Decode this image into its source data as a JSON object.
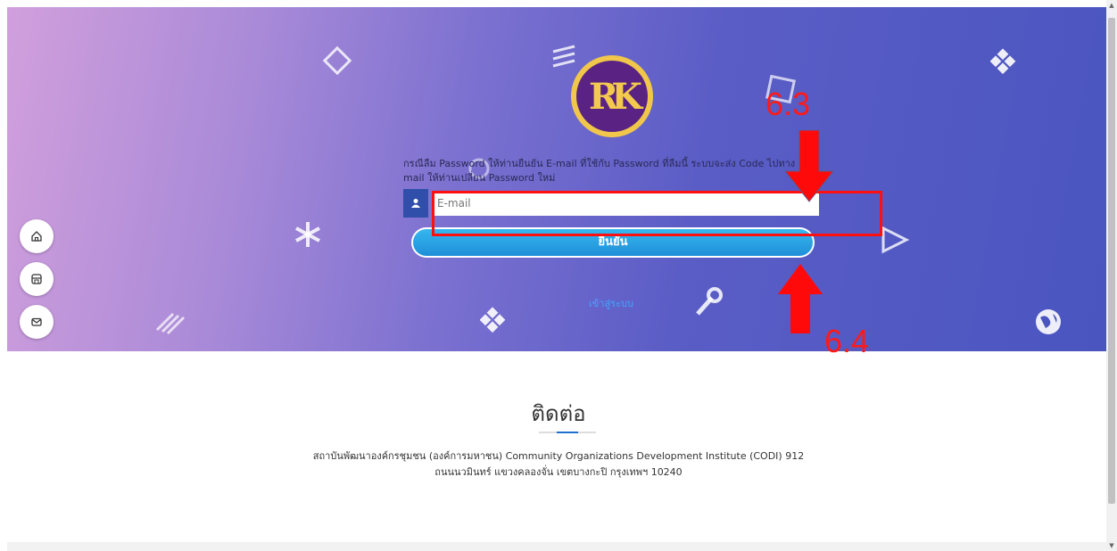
{
  "form": {
    "instruction_line1": "กรณีลืม Password ให้ท่านยืนยัน E-mail ที่ใช้กับ Password ที่ลืมนี้ ระบบจะส่ง Code ไปทาง",
    "instruction_line2": "mail ให้ท่านเปลี่ยน Password ใหม่",
    "email_placeholder": "E-mail",
    "confirm_label": "ยืนยัน",
    "login_link": "เข้าสู่ระบบ"
  },
  "logo": {
    "text": "RK"
  },
  "annotations": {
    "label_a": "6.3",
    "label_b": "6.4",
    "color": "#ff1a1a"
  },
  "side_menu": [
    {
      "icon": "home-icon"
    },
    {
      "icon": "store-icon"
    },
    {
      "icon": "mail-icon"
    }
  ],
  "contact": {
    "title": "ติดต่อ",
    "address_line1": "สถาบันพัฒนาองค์กรชุมชน (องค์การมหาชน) Community Organizations Development Institute (CODI) 912",
    "address_line2": "ถนนนวมินทร์ แขวงคลองจั่น เขตบางกะปิ กรุงเทพฯ 10240"
  },
  "colors": {
    "accent": "#1f8fd8",
    "input_icon_bg": "#2f4faa",
    "annotation": "#ff1a1a"
  }
}
